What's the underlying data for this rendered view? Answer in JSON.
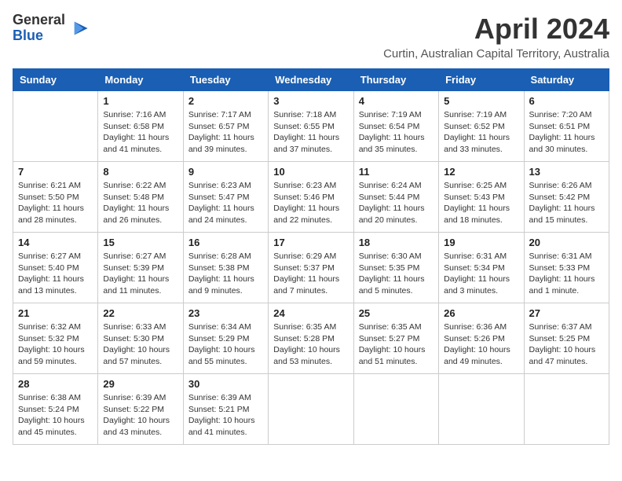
{
  "header": {
    "logo_line1": "General",
    "logo_line2": "Blue",
    "month": "April 2024",
    "location": "Curtin, Australian Capital Territory, Australia"
  },
  "days_of_week": [
    "Sunday",
    "Monday",
    "Tuesday",
    "Wednesday",
    "Thursday",
    "Friday",
    "Saturday"
  ],
  "weeks": [
    [
      {
        "day": "",
        "info": ""
      },
      {
        "day": "1",
        "info": "Sunrise: 7:16 AM\nSunset: 6:58 PM\nDaylight: 11 hours\nand 41 minutes."
      },
      {
        "day": "2",
        "info": "Sunrise: 7:17 AM\nSunset: 6:57 PM\nDaylight: 11 hours\nand 39 minutes."
      },
      {
        "day": "3",
        "info": "Sunrise: 7:18 AM\nSunset: 6:55 PM\nDaylight: 11 hours\nand 37 minutes."
      },
      {
        "day": "4",
        "info": "Sunrise: 7:19 AM\nSunset: 6:54 PM\nDaylight: 11 hours\nand 35 minutes."
      },
      {
        "day": "5",
        "info": "Sunrise: 7:19 AM\nSunset: 6:52 PM\nDaylight: 11 hours\nand 33 minutes."
      },
      {
        "day": "6",
        "info": "Sunrise: 7:20 AM\nSunset: 6:51 PM\nDaylight: 11 hours\nand 30 minutes."
      }
    ],
    [
      {
        "day": "7",
        "info": "Sunrise: 6:21 AM\nSunset: 5:50 PM\nDaylight: 11 hours\nand 28 minutes."
      },
      {
        "day": "8",
        "info": "Sunrise: 6:22 AM\nSunset: 5:48 PM\nDaylight: 11 hours\nand 26 minutes."
      },
      {
        "day": "9",
        "info": "Sunrise: 6:23 AM\nSunset: 5:47 PM\nDaylight: 11 hours\nand 24 minutes."
      },
      {
        "day": "10",
        "info": "Sunrise: 6:23 AM\nSunset: 5:46 PM\nDaylight: 11 hours\nand 22 minutes."
      },
      {
        "day": "11",
        "info": "Sunrise: 6:24 AM\nSunset: 5:44 PM\nDaylight: 11 hours\nand 20 minutes."
      },
      {
        "day": "12",
        "info": "Sunrise: 6:25 AM\nSunset: 5:43 PM\nDaylight: 11 hours\nand 18 minutes."
      },
      {
        "day": "13",
        "info": "Sunrise: 6:26 AM\nSunset: 5:42 PM\nDaylight: 11 hours\nand 15 minutes."
      }
    ],
    [
      {
        "day": "14",
        "info": "Sunrise: 6:27 AM\nSunset: 5:40 PM\nDaylight: 11 hours\nand 13 minutes."
      },
      {
        "day": "15",
        "info": "Sunrise: 6:27 AM\nSunset: 5:39 PM\nDaylight: 11 hours\nand 11 minutes."
      },
      {
        "day": "16",
        "info": "Sunrise: 6:28 AM\nSunset: 5:38 PM\nDaylight: 11 hours\nand 9 minutes."
      },
      {
        "day": "17",
        "info": "Sunrise: 6:29 AM\nSunset: 5:37 PM\nDaylight: 11 hours\nand 7 minutes."
      },
      {
        "day": "18",
        "info": "Sunrise: 6:30 AM\nSunset: 5:35 PM\nDaylight: 11 hours\nand 5 minutes."
      },
      {
        "day": "19",
        "info": "Sunrise: 6:31 AM\nSunset: 5:34 PM\nDaylight: 11 hours\nand 3 minutes."
      },
      {
        "day": "20",
        "info": "Sunrise: 6:31 AM\nSunset: 5:33 PM\nDaylight: 11 hours\nand 1 minute."
      }
    ],
    [
      {
        "day": "21",
        "info": "Sunrise: 6:32 AM\nSunset: 5:32 PM\nDaylight: 10 hours\nand 59 minutes."
      },
      {
        "day": "22",
        "info": "Sunrise: 6:33 AM\nSunset: 5:30 PM\nDaylight: 10 hours\nand 57 minutes."
      },
      {
        "day": "23",
        "info": "Sunrise: 6:34 AM\nSunset: 5:29 PM\nDaylight: 10 hours\nand 55 minutes."
      },
      {
        "day": "24",
        "info": "Sunrise: 6:35 AM\nSunset: 5:28 PM\nDaylight: 10 hours\nand 53 minutes."
      },
      {
        "day": "25",
        "info": "Sunrise: 6:35 AM\nSunset: 5:27 PM\nDaylight: 10 hours\nand 51 minutes."
      },
      {
        "day": "26",
        "info": "Sunrise: 6:36 AM\nSunset: 5:26 PM\nDaylight: 10 hours\nand 49 minutes."
      },
      {
        "day": "27",
        "info": "Sunrise: 6:37 AM\nSunset: 5:25 PM\nDaylight: 10 hours\nand 47 minutes."
      }
    ],
    [
      {
        "day": "28",
        "info": "Sunrise: 6:38 AM\nSunset: 5:24 PM\nDaylight: 10 hours\nand 45 minutes."
      },
      {
        "day": "29",
        "info": "Sunrise: 6:39 AM\nSunset: 5:22 PM\nDaylight: 10 hours\nand 43 minutes."
      },
      {
        "day": "30",
        "info": "Sunrise: 6:39 AM\nSunset: 5:21 PM\nDaylight: 10 hours\nand 41 minutes."
      },
      {
        "day": "",
        "info": ""
      },
      {
        "day": "",
        "info": ""
      },
      {
        "day": "",
        "info": ""
      },
      {
        "day": "",
        "info": ""
      }
    ]
  ]
}
